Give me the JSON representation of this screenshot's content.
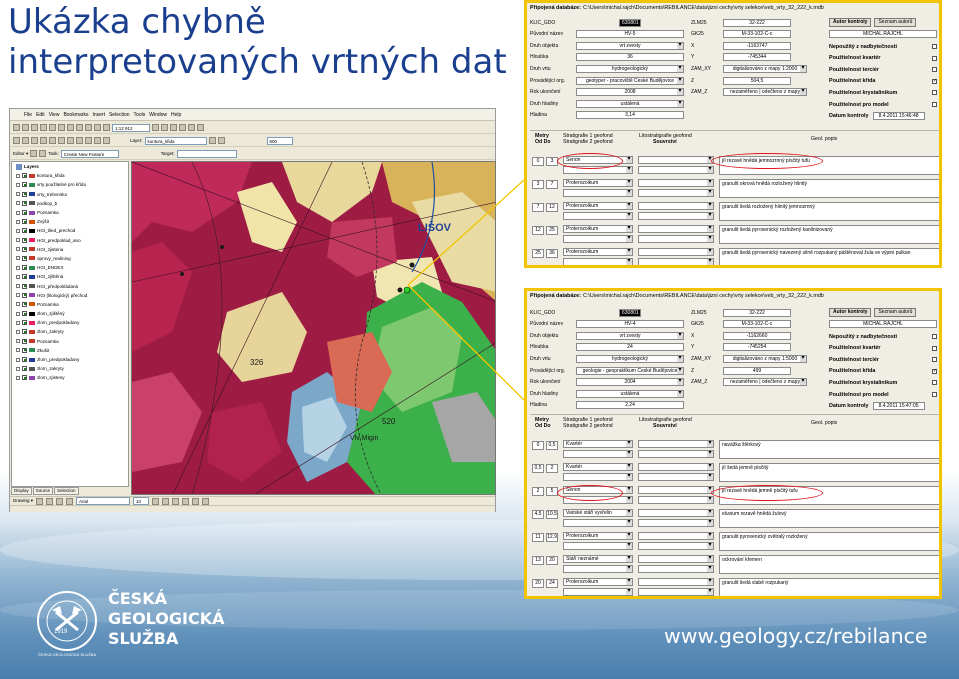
{
  "slide": {
    "title_line1": "Ukázka chybně",
    "title_line2": "interpretovaných vrtných dat",
    "url": "www.geology.cz/rebilance",
    "logo": {
      "line1": "ČESKÁ",
      "line2": "GEOLOGICKÁ",
      "line3": "SLUŽBA",
      "seal_year": "1919",
      "seal_text": "ČESKÁ GEOLOGICKÁ SLUŽBA"
    }
  },
  "gis": {
    "menu": [
      "File",
      "Edit",
      "View",
      "Bookmarks",
      "Insert",
      "Selection",
      "Tools",
      "Window",
      "Help"
    ],
    "scale": "1:12 912",
    "editor_label": "Editor ▾",
    "task_label": "Task:",
    "task_value": "Create New Feature",
    "target_label": "Target:",
    "layer_label": "Layer:",
    "layer_value": "kontura_kfida",
    "zoom_value": "500",
    "toc_title": "Layers",
    "toc_items": [
      "kontura_kfida",
      "vrty použitelné pro křídu",
      "vrty_trebonsko",
      "podkop_b",
      "Poznamka",
      "Zvýšit",
      "HGI_tiled_prechod",
      "HGI_predpoklad_ano",
      "HGI_zjistena",
      "oprovy_realining",
      "HGI_ENDEX",
      "HGI_zjištěná",
      "HGI_předpokládaná",
      "HGI (litologický) přechod",
      "Poznamka",
      "zlom_zjištěný",
      "zlom_predpokladany",
      "zlom_zakryty",
      "Poznamka",
      "Zkušit",
      "zlom_predpokladany",
      "zlom_zakryty",
      "zlom_zjisteny"
    ],
    "tabs": [
      "Display",
      "Source",
      "Selection"
    ],
    "draw_label": "Drawing ▾",
    "font_value": "Arial",
    "font_size": "10",
    "map_labels": [
      "LIŠOV",
      "326",
      "520",
      "Vlv Migin"
    ]
  },
  "db1": {
    "path_label": "Připojená databáze:",
    "path_value": "C:\\Users\\michal.rajch\\Documents\\REBILANCE\\data\\jizni cechy\\vrty selekce\\veb_vrty_32_222_k.mdb",
    "fields_left": [
      {
        "label": "KLIC_GDO",
        "value": "630801"
      },
      {
        "label": "Původní název",
        "value": "HV-5"
      },
      {
        "label": "Druh objektu",
        "value": "vrt zvesty"
      },
      {
        "label": "Hloubka",
        "value": "36"
      },
      {
        "label": "Druh vrtu",
        "value": "hydrogeologický"
      },
      {
        "label": "Provádějící org.",
        "value": "geotyper - pracoviště České Budějovice"
      },
      {
        "label": "Rok ukončení",
        "value": "2008"
      },
      {
        "label": "Druh hladiny",
        "value": "ustálená"
      },
      {
        "label": "Hladina",
        "value": "3,14"
      }
    ],
    "fields_mid": [
      {
        "label": "ZLM25",
        "value": "32-222"
      },
      {
        "label": "GK25",
        "value": "M-33-102-C-c"
      },
      {
        "label": "X",
        "value": "-1163747"
      },
      {
        "label": "Y",
        "value": "-745344"
      },
      {
        "label": "ZAM_XY",
        "value": "digitalizováno z mapy 1:2000"
      },
      {
        "label": "Z",
        "value": "504,5"
      },
      {
        "label": "ZAM_Z",
        "value": "nezaměřeno | odečteno z mapy"
      }
    ],
    "author_btn": "Autor kontroly",
    "author_list_btn": "Seznam autorů",
    "author_value": "MICHAL.RAJCHL",
    "checks": [
      {
        "label": "Nepoužitý z nadbytečnosti",
        "checked": false
      },
      {
        "label": "Použitelnost kvartér",
        "checked": false
      },
      {
        "label": "Použitelnost terciér",
        "checked": false
      },
      {
        "label": "Použitelnost křída",
        "checked": true
      },
      {
        "label": "Použitelnost krystalinikum",
        "checked": false
      },
      {
        "label": "Použitelnost pro model",
        "checked": false
      }
    ],
    "date_label": "Datum kontroly",
    "date_value": "8.4.2011 15:46:48",
    "col_hloubka": "Metry",
    "col_od_do": "Od  Do",
    "col_strat1": "Stratigrafie 1 geofond",
    "col_strat2": "Stratigrafie 2 geofond",
    "col_lito": "Litostratigrafie geofond",
    "col_souvrstvi": "Souvrství",
    "col_geol": "Geol. popis",
    "layers": [
      {
        "od": "0",
        "do": "3",
        "strat": "Senon",
        "desc": "jíl rezavě hnědá   jemnozrnný písčitý tufu"
      },
      {
        "od": "3",
        "do": "7",
        "strat": "Proterozoikum",
        "desc": "granulit okrová hnědá   rozložený hlinitý"
      },
      {
        "od": "7",
        "do": "12",
        "strat": "Proterozoikum",
        "desc": "granulit šedá   rozložený hlinitý jemnozrnný"
      },
      {
        "od": "12",
        "do": "25",
        "strat": "Proterozoikum",
        "desc": "granulit šedá   pyroxenický rozložený kaolinizovaný"
      },
      {
        "od": "25",
        "do": "36",
        "strat": "Proterozoikum",
        "desc": "granulit šedá   pyroxenický navezený silně rozpukaný   páštěnoval žula   ve výpini pulkan"
      }
    ]
  },
  "db2": {
    "path_label": "Připojená databáze:",
    "path_value": "C:\\Users\\michal.rajch\\Documents\\REBILANCE\\data\\jizni cechy\\vrty selekce\\veb_vrty_32_222_k.mdb",
    "fields_left": [
      {
        "label": "KLIC_GDO",
        "value": "630801"
      },
      {
        "label": "Původní název",
        "value": "HV-4"
      },
      {
        "label": "Druh objektu",
        "value": "vrt zvesty"
      },
      {
        "label": "Hloubka",
        "value": "24"
      },
      {
        "label": "Druh vrtu",
        "value": "hydrogeologický"
      },
      {
        "label": "Provádějící org.",
        "value": "geologie - geopraktikum České Budějovice"
      },
      {
        "label": "Rok ukončení",
        "value": "2004"
      },
      {
        "label": "Druh hladiny",
        "value": "ustálená"
      },
      {
        "label": "Hladina",
        "value": "2,24"
      }
    ],
    "fields_mid": [
      {
        "label": "ZLM25",
        "value": "32-222"
      },
      {
        "label": "GK25",
        "value": "M-33-102-C-c"
      },
      {
        "label": "X",
        "value": "-1162660"
      },
      {
        "label": "Y",
        "value": "-745254"
      },
      {
        "label": "ZAM_XY",
        "value": "digitalizováno z mapy 1:5000"
      },
      {
        "label": "Z",
        "value": "499"
      },
      {
        "label": "ZAM_Z",
        "value": "nezaměřeno | odečteno z mapy"
      }
    ],
    "author_btn": "Autor kontroly",
    "author_list_btn": "Seznam autorů",
    "author_value": "MICHAL.RAJCHL",
    "checks": [
      {
        "label": "Nepoužitý z nadbytečnosti",
        "checked": false
      },
      {
        "label": "Použitelnost kvartér",
        "checked": false
      },
      {
        "label": "Použitelnost terciér",
        "checked": false
      },
      {
        "label": "Použitelnost křída",
        "checked": true
      },
      {
        "label": "Použitelnost krystalinikum",
        "checked": false
      },
      {
        "label": "Použitelnost pro model",
        "checked": false
      }
    ],
    "date_label": "Datum kontroly",
    "date_value": "8.4.2011 15:47:05",
    "col_hloubka": "Metry",
    "col_od_do": "Od  Do",
    "col_strat1": "Stratigrafie 1 geofond",
    "col_strat2": "Stratigrafie 2 geofond",
    "col_lito": "Litostratigrafie geofond",
    "col_souvrstvi": "Souvrství",
    "col_geol": "Geol. popis",
    "layers": [
      {
        "od": "0",
        "do": "0,5",
        "strat": "Kvartér",
        "desc": "navážka   štěrkový"
      },
      {
        "od": "0,5",
        "do": "2",
        "strat": "Kvartér",
        "desc": "jíl šedá   jemně písčitý"
      },
      {
        "od": "2",
        "do": "5",
        "strat": "Senon",
        "desc": "jíl rezavě hnědá   jemně písčitý tufu"
      },
      {
        "od": "4,5",
        "do": "10,5",
        "strat": "Variské stáří vyvřelin",
        "desc": "eluvium rezavě hnědá   žulový"
      },
      {
        "od": "11",
        "do": "12,9",
        "strat": "Proterozoikum",
        "desc": "granulit   pyroxenický zvětralý rozložený"
      },
      {
        "od": "13",
        "do": "20",
        "strat": "Stáří neznámé",
        "desc": "ockrování křemen"
      },
      {
        "od": "20",
        "do": "24",
        "strat": "Proterozoikum",
        "desc": "granulit šedá   slabě rozpukaný"
      }
    ]
  }
}
